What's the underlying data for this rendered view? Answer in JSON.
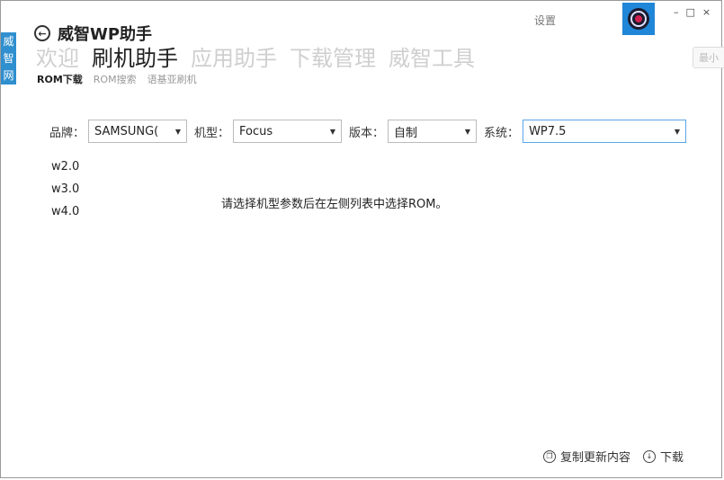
{
  "left_strip": {
    "chars": [
      "威",
      "智",
      "网"
    ]
  },
  "header": {
    "back_glyph": "←",
    "title": "威智WP助手",
    "settings_label": "设置",
    "tabs": [
      {
        "label": "欢迎",
        "active": false
      },
      {
        "label": "刷机助手",
        "active": true
      },
      {
        "label": "应用助手",
        "active": false
      },
      {
        "label": "下载管理",
        "active": false
      },
      {
        "label": "威智工具",
        "active": false
      }
    ],
    "subtabs": [
      {
        "label": "ROM下载",
        "active": true
      },
      {
        "label": "ROM搜索",
        "active": false
      },
      {
        "label": "语基亚刷机",
        "active": false
      }
    ],
    "window_controls": {
      "min": "–",
      "max": "□",
      "close": "×"
    },
    "side_button_label": "最小"
  },
  "filters": {
    "brand_label": "品牌：",
    "brand_value": "SAMSUNG(",
    "model_label": "机型：",
    "model_value": "Focus",
    "version_label": "版本：",
    "version_value": "自制",
    "system_label": "系统：",
    "system_value": "WP7.5"
  },
  "versions": [
    "w2.0",
    "w3.0",
    "w4.0"
  ],
  "message": "请选择机型参数后在左侧列表中选择ROM。",
  "actions": {
    "copy_label": "复制更新内容",
    "download_label": "下载"
  },
  "colors": {
    "accent": "#2086d8",
    "inactive_tab": "#cfcfcf"
  }
}
